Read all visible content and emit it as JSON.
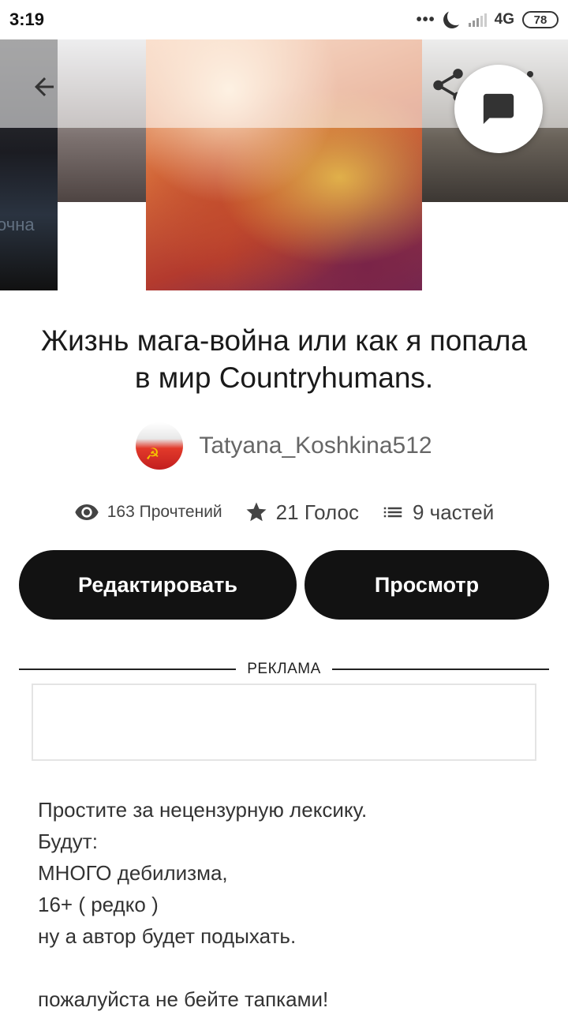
{
  "status_bar": {
    "time": "3:19",
    "dots": "•••",
    "network": "4G",
    "battery": "78"
  },
  "cover": {
    "left_ghost_text": "очна"
  },
  "story": {
    "title": "Жизнь мага-война или как я попала в мир Countryhumans.",
    "author": "Tatyana_Koshkina512",
    "reads": "163 Прочтений",
    "votes": "21 Голос",
    "parts": "9 частей"
  },
  "actions": {
    "edit_label": "Редактировать",
    "view_label": "Просмотр"
  },
  "ad": {
    "label": "РЕКЛАМА"
  },
  "description": {
    "lines": [
      "Простите за нецензурную лексику.",
      "Будут:",
      "МНОГО дебилизма,",
      "16+ ( редко )",
      "ну а автор будет подыхать.",
      "",
      "пожалуйста не бейте тапками!"
    ]
  },
  "icons": {
    "back": "arrow-back-icon",
    "share": "share-icon",
    "more": "more-vert-icon",
    "chat": "chat-bubble-icon",
    "reads": "eye-icon",
    "votes": "star-icon",
    "parts": "list-icon"
  }
}
